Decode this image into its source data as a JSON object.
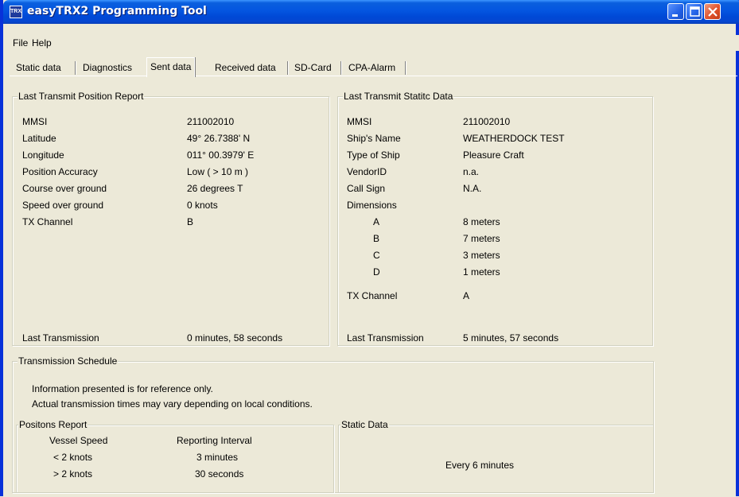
{
  "window": {
    "title": "easyTRX2 Programming Tool",
    "icon_text": "TRX"
  },
  "menu": {
    "file": "File",
    "help": "Help"
  },
  "tabs": [
    "Static data",
    "Diagnostics",
    "Sent data",
    "Received data",
    "SD-Card",
    "CPA-Alarm"
  ],
  "position_report": {
    "title": "Last Transmit Position Report",
    "rows": [
      {
        "label": "MMSI",
        "value": "211002010"
      },
      {
        "label": "Latitude",
        "value": "49° 26.7388' N"
      },
      {
        "label": "Longitude",
        "value": "011° 00.3979' E"
      },
      {
        "label": "Position Accuracy",
        "value": "Low ( > 10 m )"
      },
      {
        "label": "Course over ground",
        "value": "26 degrees T"
      },
      {
        "label": "Speed over ground",
        "value": "0 knots"
      },
      {
        "label": "TX Channel",
        "value": "B"
      }
    ],
    "last_label": "Last Transmission",
    "last_value": "0 minutes, 58 seconds"
  },
  "static_data": {
    "title": "Last Transmit Statitc Data",
    "rows": [
      {
        "label": "MMSI",
        "value": "211002010"
      },
      {
        "label": "Ship's Name",
        "value": "WEATHERDOCK TEST"
      },
      {
        "label": "Type of Ship",
        "value": "Pleasure Craft"
      },
      {
        "label": "VendorID",
        "value": "n.a."
      },
      {
        "label": "Call Sign",
        "value": "N.A."
      },
      {
        "label": "Dimensions",
        "value": ""
      }
    ],
    "dimensions": [
      {
        "label": "A",
        "value": "8 meters"
      },
      {
        "label": "B",
        "value": "7 meters"
      },
      {
        "label": "C",
        "value": "3 meters"
      },
      {
        "label": "D",
        "value": "1 meters"
      }
    ],
    "tx_label": "TX Channel",
    "tx_value": "A",
    "last_label": "Last Transmission",
    "last_value": "5 minutes, 57 seconds"
  },
  "schedule": {
    "title": "Transmission Schedule",
    "line1": "Information presented is for reference only.",
    "line2": "Actual transmission times may vary depending on local conditions."
  },
  "positions_report": {
    "title": "Positons Report",
    "col1": "Vessel Speed",
    "col2": "Reporting Interval",
    "rows": [
      {
        "speed": "< 2 knots",
        "interval": "3 minutes"
      },
      {
        "speed": "> 2 knots",
        "interval": "30 seconds"
      }
    ]
  },
  "static_schedule": {
    "title": "Static Data",
    "value": "Every 6 minutes"
  },
  "colors": {
    "titlebar": "#0455e0",
    "window_bg": "#ece9d8",
    "close": "#e0522c"
  }
}
